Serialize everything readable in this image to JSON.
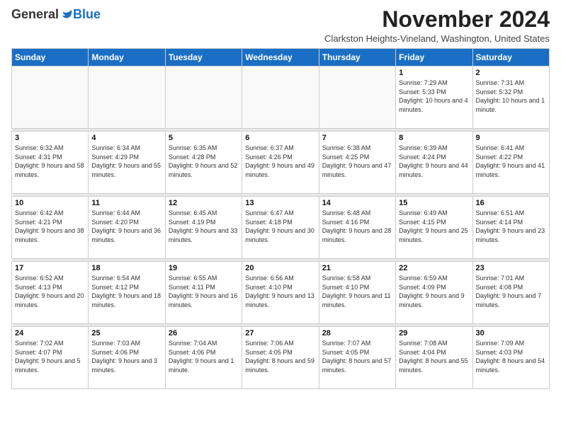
{
  "logo": {
    "general": "General",
    "blue": "Blue"
  },
  "header": {
    "title": "November 2024",
    "subtitle": "Clarkston Heights-Vineland, Washington, United States"
  },
  "days_of_week": [
    "Sunday",
    "Monday",
    "Tuesday",
    "Wednesday",
    "Thursday",
    "Friday",
    "Saturday"
  ],
  "weeks": [
    [
      {
        "day": "",
        "info": ""
      },
      {
        "day": "",
        "info": ""
      },
      {
        "day": "",
        "info": ""
      },
      {
        "day": "",
        "info": ""
      },
      {
        "day": "",
        "info": ""
      },
      {
        "day": "1",
        "info": "Sunrise: 7:29 AM\nSunset: 5:33 PM\nDaylight: 10 hours\nand 4 minutes."
      },
      {
        "day": "2",
        "info": "Sunrise: 7:31 AM\nSunset: 5:32 PM\nDaylight: 10 hours\nand 1 minute."
      }
    ],
    [
      {
        "day": "3",
        "info": "Sunrise: 6:32 AM\nSunset: 4:31 PM\nDaylight: 9 hours\nand 58 minutes."
      },
      {
        "day": "4",
        "info": "Sunrise: 6:34 AM\nSunset: 4:29 PM\nDaylight: 9 hours\nand 55 minutes."
      },
      {
        "day": "5",
        "info": "Sunrise: 6:35 AM\nSunset: 4:28 PM\nDaylight: 9 hours\nand 52 minutes."
      },
      {
        "day": "6",
        "info": "Sunrise: 6:37 AM\nSunset: 4:26 PM\nDaylight: 9 hours\nand 49 minutes."
      },
      {
        "day": "7",
        "info": "Sunrise: 6:38 AM\nSunset: 4:25 PM\nDaylight: 9 hours\nand 47 minutes."
      },
      {
        "day": "8",
        "info": "Sunrise: 6:39 AM\nSunset: 4:24 PM\nDaylight: 9 hours\nand 44 minutes."
      },
      {
        "day": "9",
        "info": "Sunrise: 6:41 AM\nSunset: 4:22 PM\nDaylight: 9 hours\nand 41 minutes."
      }
    ],
    [
      {
        "day": "10",
        "info": "Sunrise: 6:42 AM\nSunset: 4:21 PM\nDaylight: 9 hours\nand 38 minutes."
      },
      {
        "day": "11",
        "info": "Sunrise: 6:44 AM\nSunset: 4:20 PM\nDaylight: 9 hours\nand 36 minutes."
      },
      {
        "day": "12",
        "info": "Sunrise: 6:45 AM\nSunset: 4:19 PM\nDaylight: 9 hours\nand 33 minutes."
      },
      {
        "day": "13",
        "info": "Sunrise: 6:47 AM\nSunset: 4:18 PM\nDaylight: 9 hours\nand 30 minutes."
      },
      {
        "day": "14",
        "info": "Sunrise: 6:48 AM\nSunset: 4:16 PM\nDaylight: 9 hours\nand 28 minutes."
      },
      {
        "day": "15",
        "info": "Sunrise: 6:49 AM\nSunset: 4:15 PM\nDaylight: 9 hours\nand 25 minutes."
      },
      {
        "day": "16",
        "info": "Sunrise: 6:51 AM\nSunset: 4:14 PM\nDaylight: 9 hours\nand 23 minutes."
      }
    ],
    [
      {
        "day": "17",
        "info": "Sunrise: 6:52 AM\nSunset: 4:13 PM\nDaylight: 9 hours\nand 20 minutes."
      },
      {
        "day": "18",
        "info": "Sunrise: 6:54 AM\nSunset: 4:12 PM\nDaylight: 9 hours\nand 18 minutes."
      },
      {
        "day": "19",
        "info": "Sunrise: 6:55 AM\nSunset: 4:11 PM\nDaylight: 9 hours\nand 16 minutes."
      },
      {
        "day": "20",
        "info": "Sunrise: 6:56 AM\nSunset: 4:10 PM\nDaylight: 9 hours\nand 13 minutes."
      },
      {
        "day": "21",
        "info": "Sunrise: 6:58 AM\nSunset: 4:10 PM\nDaylight: 9 hours\nand 11 minutes."
      },
      {
        "day": "22",
        "info": "Sunrise: 6:59 AM\nSunset: 4:09 PM\nDaylight: 9 hours\nand 9 minutes."
      },
      {
        "day": "23",
        "info": "Sunrise: 7:01 AM\nSunset: 4:08 PM\nDaylight: 9 hours\nand 7 minutes."
      }
    ],
    [
      {
        "day": "24",
        "info": "Sunrise: 7:02 AM\nSunset: 4:07 PM\nDaylight: 9 hours\nand 5 minutes."
      },
      {
        "day": "25",
        "info": "Sunrise: 7:03 AM\nSunset: 4:06 PM\nDaylight: 9 hours\nand 3 minutes."
      },
      {
        "day": "26",
        "info": "Sunrise: 7:04 AM\nSunset: 4:06 PM\nDaylight: 9 hours\nand 1 minute."
      },
      {
        "day": "27",
        "info": "Sunrise: 7:06 AM\nSunset: 4:05 PM\nDaylight: 8 hours\nand 59 minutes."
      },
      {
        "day": "28",
        "info": "Sunrise: 7:07 AM\nSunset: 4:05 PM\nDaylight: 8 hours\nand 57 minutes."
      },
      {
        "day": "29",
        "info": "Sunrise: 7:08 AM\nSunset: 4:04 PM\nDaylight: 8 hours\nand 55 minutes."
      },
      {
        "day": "30",
        "info": "Sunrise: 7:09 AM\nSunset: 4:03 PM\nDaylight: 8 hours\nand 54 minutes."
      }
    ]
  ]
}
